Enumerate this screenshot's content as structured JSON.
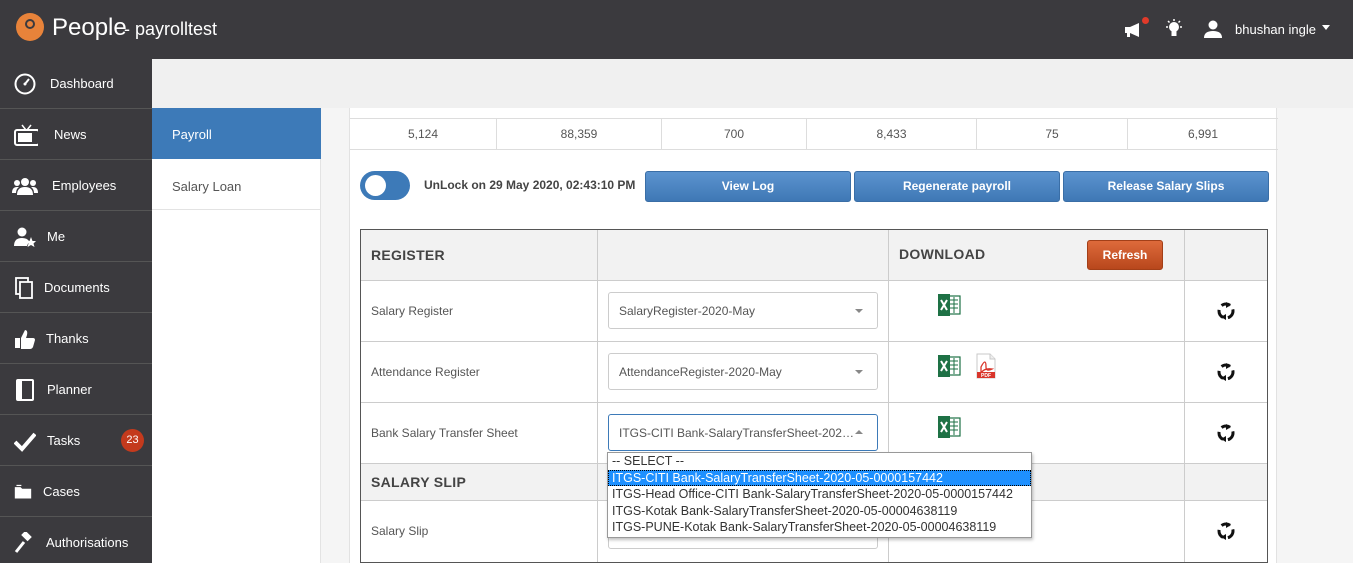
{
  "header": {
    "app_name": "People",
    "company": "- payrolltest",
    "user_name": "bhushan ingle",
    "icons": [
      "announcement-icon",
      "idea-bulb-icon",
      "user-icon"
    ]
  },
  "sidebar": {
    "items": [
      {
        "label": "Dashboard",
        "icon": "dashboard-icon"
      },
      {
        "label": "News",
        "icon": "tv-icon"
      },
      {
        "label": "Employees",
        "icon": "group-icon"
      },
      {
        "label": "Me",
        "icon": "user-star-icon"
      },
      {
        "label": "Documents",
        "icon": "documents-icon"
      },
      {
        "label": "Thanks",
        "icon": "thumbs-up-icon"
      },
      {
        "label": "Planner",
        "icon": "notebook-icon"
      },
      {
        "label": "Tasks",
        "icon": "check-icon",
        "badge": "23"
      },
      {
        "label": "Cases",
        "icon": "folder-icon"
      },
      {
        "label": "Authorisations",
        "icon": "gavel-icon"
      }
    ]
  },
  "subnav": {
    "active": "Payroll",
    "items": [
      "Salary Loan"
    ]
  },
  "totals": [
    "5,124",
    "88,359",
    "700",
    "8,433",
    "75",
    "6,991"
  ],
  "lock": {
    "text": "UnLock on 29 May 2020, 02:43:10 PM"
  },
  "actions": {
    "view_log": "View Log",
    "regenerate": "Regenerate payroll",
    "release": "Release Salary Slips"
  },
  "register": {
    "header": "REGISTER",
    "download_header": "DOWNLOAD",
    "refresh_label": "Refresh",
    "rows": [
      {
        "label": "Salary Register",
        "selected": "SalaryRegister-2020-May"
      },
      {
        "label": "Attendance Register",
        "selected": "AttendanceRegister-2020-May"
      },
      {
        "label": "Bank Salary Transfer Sheet",
        "selected": "ITGS-CITI Bank-SalaryTransferSheet-2020-05-0000157442"
      }
    ]
  },
  "salary_slip": {
    "header": "SALARY SLIP",
    "rows": [
      {
        "label": "Salary Slip"
      }
    ]
  },
  "dropdown": {
    "options": [
      "-- SELECT --",
      "ITGS-CITI Bank-SalaryTransferSheet-2020-05-0000157442",
      "ITGS-Head Office-CITI Bank-SalaryTransferSheet-2020-05-0000157442",
      "ITGS-Kotak Bank-SalaryTransferSheet-2020-05-00004638119",
      "ITGS-PUNE-Kotak Bank-SalaryTransferSheet-2020-05-00004638119"
    ],
    "selected_index": 1
  },
  "colors": {
    "topbar": "#3b3a3e",
    "accent_blue": "#3d7ab8",
    "refresh_orange": "#c45326",
    "badge_red": "#c43a1d"
  }
}
